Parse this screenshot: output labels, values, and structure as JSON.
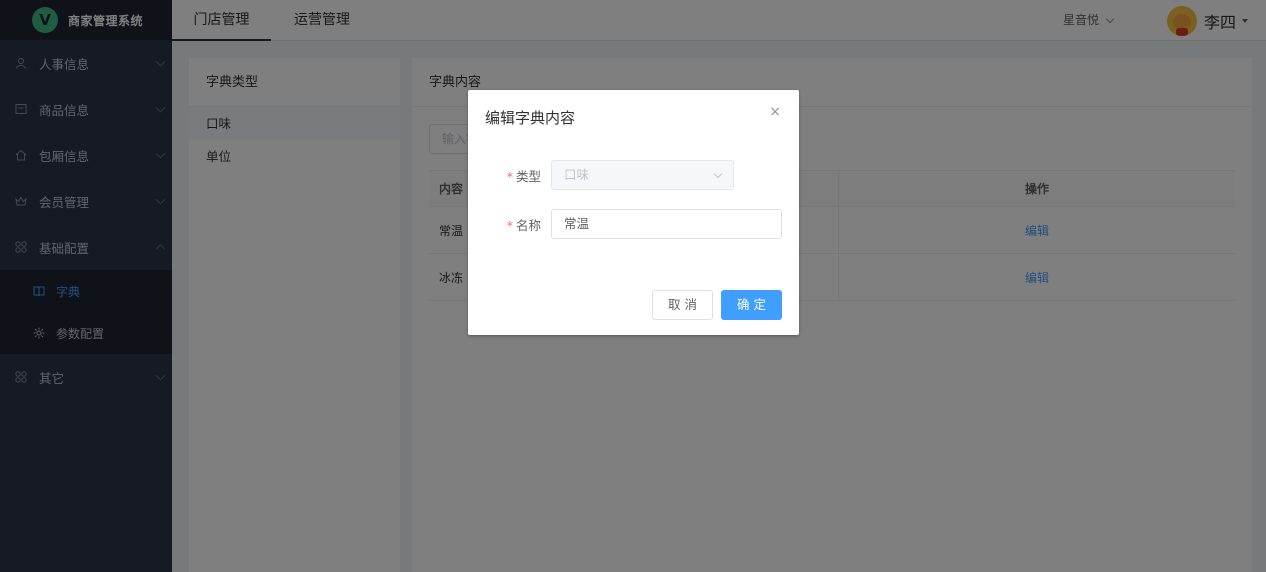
{
  "app": {
    "title": "商家管理系统",
    "logo_letter": "V"
  },
  "sidebar": {
    "items": [
      {
        "label": "人事信息",
        "icon": "user-icon"
      },
      {
        "label": "商品信息",
        "icon": "box-icon"
      },
      {
        "label": "包厢信息",
        "icon": "home-icon"
      },
      {
        "label": "会员管理",
        "icon": "crown-icon"
      },
      {
        "label": "基础配置",
        "icon": "grid-icon"
      },
      {
        "label": "其它",
        "icon": "grid-icon"
      }
    ],
    "sub_items": [
      {
        "label": "字典",
        "icon": "book-icon"
      },
      {
        "label": "参数配置",
        "icon": "gear-icon"
      }
    ]
  },
  "header": {
    "tabs": [
      {
        "label": "门店管理"
      },
      {
        "label": "运营管理"
      }
    ],
    "store": "星音悦",
    "user": "李四"
  },
  "left_panel": {
    "title": "字典类型",
    "items": [
      {
        "label": "口味"
      },
      {
        "label": "单位"
      }
    ]
  },
  "right_panel": {
    "title": "字典内容",
    "search_placeholder": "输入字典内容",
    "columns": {
      "content": "内容",
      "action": "操作"
    },
    "rows": [
      {
        "content": "常温",
        "action": "编辑"
      },
      {
        "content": "冰冻",
        "action": "编辑"
      }
    ]
  },
  "dialog": {
    "title": "编辑字典内容",
    "close": "×",
    "type_label": "类型",
    "type_value": "口味",
    "name_label": "名称",
    "name_value": "常温",
    "required_mark": "*",
    "cancel": "取 消",
    "confirm": "确 定"
  },
  "colors": {
    "primary": "#409eff",
    "sidebar_bg": "#2b3546",
    "required": "#f56c6c"
  }
}
